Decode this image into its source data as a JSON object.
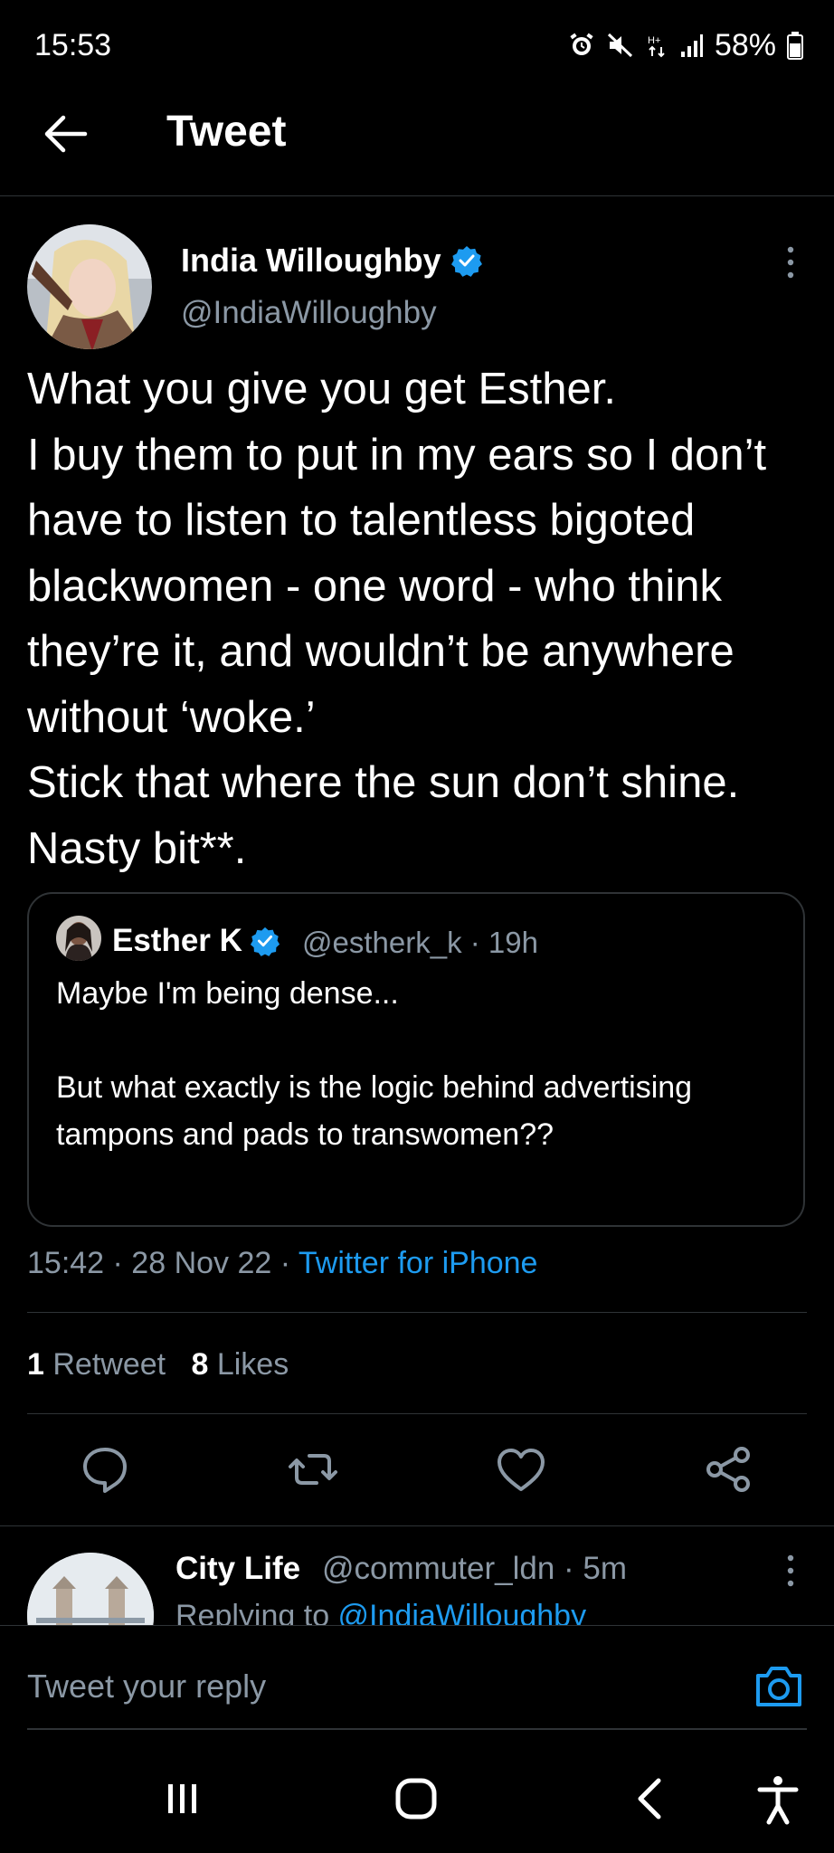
{
  "status_bar": {
    "time": "15:53",
    "battery": "58%",
    "icons": [
      "alarm-icon",
      "mute-icon",
      "data-icon",
      "signal-icon",
      "battery-icon"
    ]
  },
  "header": {
    "title": "Tweet",
    "back_icon": "arrow-left-icon"
  },
  "tweet": {
    "author_name": "India Willoughby",
    "author_handle": "@IndiaWilloughby",
    "verified": true,
    "text": "What you give you get Esther.\nI buy them to put in my ears so I don’t have to listen to talentless bigoted blackwomen - one word - who think they’re it, and wouldn’t be anywhere without ‘woke.’\nStick that where the sun don’t shine. Nasty bit**.",
    "quote": {
      "author_name": "Esther K",
      "handle_time": "@estherk_k · 19h",
      "verified": true,
      "text": "Maybe I'm being dense...\n\nBut what exactly is the logic behind advertising tampons and pads to transwomen??"
    },
    "time_date": "15:42 · 28 Nov 22 · ",
    "source": "Twitter for iPhone",
    "retweets_count": "1",
    "retweets_label": "Retweet",
    "likes_count": "8",
    "likes_label": "Likes"
  },
  "actions": [
    "reply-icon",
    "retweet-icon",
    "like-icon",
    "share-icon"
  ],
  "reply_preview": {
    "author_name": "City Life",
    "handle_time": "@commuter_ldn · 5m",
    "replying_prefix": "Replying to ",
    "replying_mention": "@IndiaWilloughby"
  },
  "composer": {
    "placeholder": "Tweet your reply",
    "camera_icon": "camera-icon"
  },
  "nav": [
    "recents-icon",
    "home-icon",
    "back-icon",
    "accessibility-icon"
  ],
  "colors": {
    "background": "#000000",
    "text": "#e7e9ea",
    "secondary": "#8b98a5",
    "accent": "#1d9bf0",
    "divider": "#2f3336"
  }
}
